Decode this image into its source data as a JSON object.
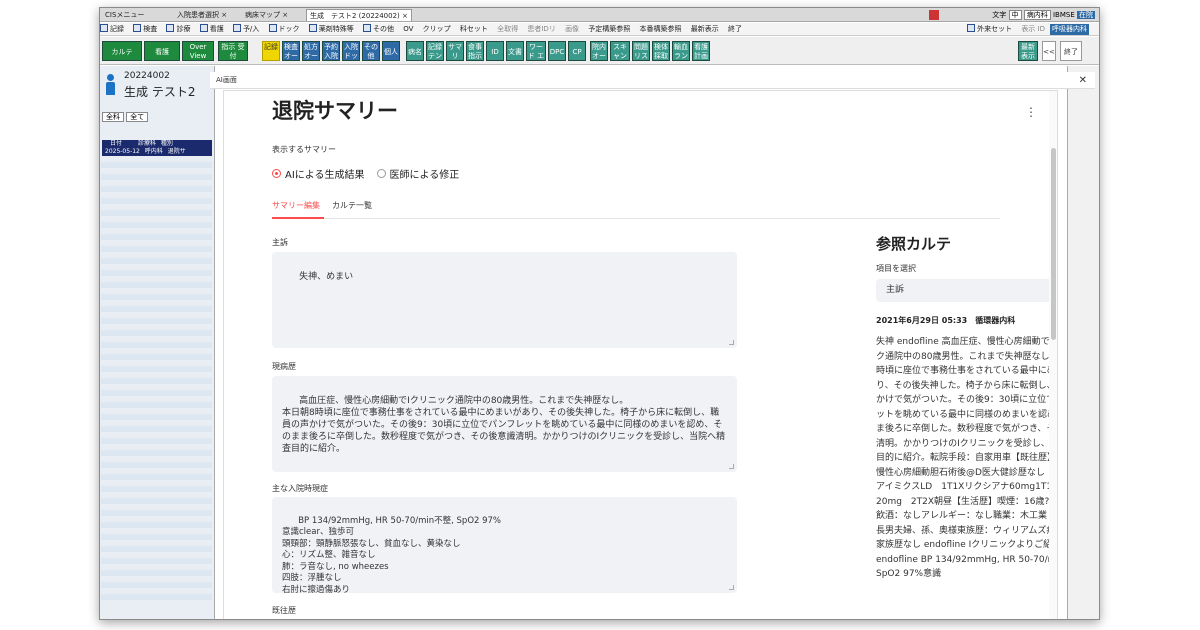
{
  "tabs": [
    {
      "label": "CISメニュー",
      "active": false
    },
    {
      "label": "入院患者選択 ×",
      "active": false
    },
    {
      "label": "病床マップ ×",
      "active": false
    },
    {
      "label": "生成　テスト2 (20224002) ×",
      "active": true
    }
  ],
  "menubar": [
    "記録",
    "検査",
    "診療",
    "看護",
    "予/入",
    "ドック",
    "薬剤特殊等",
    "その他",
    "OV",
    "クリップ",
    "科セット",
    "全取得",
    "患者IDリ",
    "画像",
    "予定構築参照",
    "本番構築参照",
    "最新表示",
    "終了"
  ],
  "menubar_right": [
    "外来セット",
    "表示 ID"
  ],
  "header_right": {
    "text_label": "文字",
    "size": "中",
    "dept": "病内科",
    "ibmse": "IBMSE",
    "status": "在院",
    "dept_button": "呼吸器内科"
  },
  "toolbar_left": [
    "カルテ",
    "看護",
    "Over View",
    "指示 受付"
  ],
  "toolbar_icons": [
    "記録",
    "検査 オーダ",
    "処方 オーダ",
    "予約 入院",
    "入院 ドック",
    "その他",
    "個人",
    "病名",
    "記録 テンプ",
    "サマ リ",
    "食事 指示",
    "ID",
    "文書",
    "ワード エクセル",
    "DPC",
    "CP",
    "院内 オーダ",
    "スキャン ビュー",
    "問題 リスト",
    "検体 採取",
    "輸血 ラン",
    "看護 計画"
  ],
  "toolbar_right": [
    "最新 表示",
    "<<",
    "終了"
  ],
  "patient": {
    "id": "20224002",
    "name": "生成 テスト2"
  },
  "left_filters": [
    "全科",
    "全て"
  ],
  "left_table": {
    "headers": [
      "日付",
      "診療科",
      "種別"
    ],
    "row": [
      "2025-05-12",
      "呼内科",
      "退院サ"
    ]
  },
  "modal_header": "AI画面",
  "modal": {
    "title": "退院サマリー",
    "summary_label": "表示するサマリー",
    "radio_options": [
      "AIによる生成結果",
      "医師による修正"
    ],
    "selected_radio": 0,
    "subtabs": [
      "サマリー編集",
      "カルテ一覧"
    ],
    "fields": [
      {
        "label": "主訴",
        "value": "失神、めまい"
      },
      {
        "label": "現病歴",
        "value": "高血圧症、慢性心房細動でIクリニック通院中の80歳男性。これまで失神歴なし。\n本日朝8時頃に座位で事務仕事をされている最中にめまいがあり、その後失神した。椅子から床に転倒し、職員の声かけで気がついた。その後9：30頃に立位でパンフレットを眺めている最中に同様のめまいを認め、そのまま後ろに卒倒した。数秒程度で気がつき、その後意識清明。かかりつけのIクリニックを受診し、当院へ精査目的に紹介。"
      },
      {
        "label": "主な入院時現症",
        "value": "BP 134/92mmHg, HR 50-70/min不整, SpO2 97%\n意識clear、独歩可\n頭頸部：頸静脈怒張なし、貧血なし、黄染なし\n心：リズム整、雑音なし\n肺：ラ音なし, no wheezes\n四肢：浮腫なし\n右肘に擦過傷あり"
      },
      {
        "label": "既往歴",
        "value": ""
      }
    ],
    "ref": {
      "title": "参照カルテ",
      "select_label": "項目を選択",
      "selected": "主訴",
      "date": "2021年6月29日 05:33　循環器内科",
      "text": "失神 endofline 高血圧症、慢性心房細動でIクリニック通院中の80歳男性。これまで失神歴なし。本日朝8時頃に座位で事務仕事をされている最中にめまいがあり、その後失神した。椅子から床に転倒し、職員の声かけで気がついた。その後9：30頃に立位でパンフレットを眺めている最中に同様のめまいを認め、そのまま後ろに卒倒した。数秒程度で気がつき、その後意識清明。かかりつけのIクリニックを受診し、当院へ精査目的に紹介。転院手段：自家用車【既往歴】高血圧症慢性心房細動胆石術後@D医大健診歴なし【内服歴】アイミクスLD　1T1Xリクシアナ60mg1T1Xゼロゲン20mg　2T2X朝昼【生活歴】喫煙：16歳?　40本/日飲酒：なしアレルギー：なし職業：木工業【住まい】長男夫婦、孫、奥様東族歴：ウィリアムズ病心疾患の家族歴なし endofline Iクリニックよりご紹介 endofline BP 134/92mmHg, HR 50-70/min不整, SpO2 97%意識"
    }
  },
  "colors": {
    "accent": "#ff4b4b",
    "textarea_bg": "#f0f2f6",
    "toolbar_green": "#1e8a3d"
  }
}
